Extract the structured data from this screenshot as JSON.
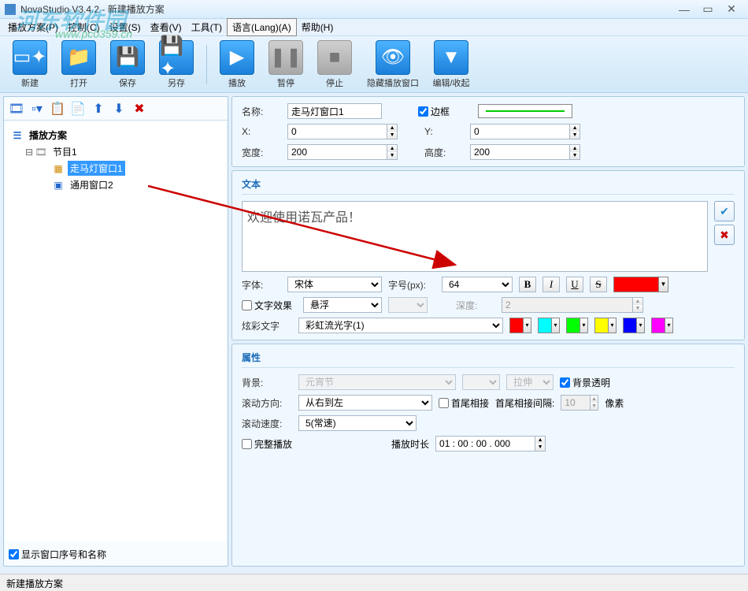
{
  "watermark": {
    "text": "河东软件园",
    "url": "www.pc0359.cn"
  },
  "title": "NovaStudio V3.4.2 - 新建播放方案",
  "menu": [
    "播放方案(P)",
    "控制(C)",
    "设置(S)",
    "查看(V)",
    "工具(T)",
    "语言(Lang)(A)",
    "帮助(H)"
  ],
  "toolbar": [
    {
      "label": "新建",
      "icon": "new"
    },
    {
      "label": "打开",
      "icon": "open"
    },
    {
      "label": "保存",
      "icon": "save"
    },
    {
      "label": "另存",
      "icon": "saveas"
    },
    {
      "label": "播放",
      "icon": "play"
    },
    {
      "label": "暂停",
      "icon": "pause",
      "disabled": true
    },
    {
      "label": "停止",
      "icon": "stop",
      "disabled": true
    },
    {
      "label": "隐藏播放窗口",
      "icon": "hide"
    },
    {
      "label": "编辑/收起",
      "icon": "collapse"
    }
  ],
  "tree": {
    "root": "播放方案",
    "program": "节目1",
    "window1": "走马灯窗口1",
    "window2": "通用窗口2"
  },
  "show_window_label": "显示窗口序号和名称",
  "props": {
    "name_label": "名称:",
    "name_value": "走马灯窗口1",
    "border_label": "边框",
    "x_label": "X:",
    "x_value": "0",
    "y_label": "Y:",
    "y_value": "0",
    "width_label": "宽度:",
    "width_value": "200",
    "height_label": "高度:",
    "height_value": "200"
  },
  "text": {
    "group_label": "文本",
    "content": "欢迎使用诺瓦产品！",
    "font_label": "字体:",
    "font_value": "宋体",
    "size_label": "字号(px):",
    "size_value": "64",
    "bold": "B",
    "italic": "I",
    "underline": "U",
    "strike": "S",
    "color": "#ff0000",
    "effect_label": "文字效果",
    "effect_value": "悬浮",
    "depth_label": "深度:",
    "depth_value": "2",
    "colorful_label": "炫彩文字",
    "colorful_value": "彩虹流光字(1)",
    "swatches": [
      "#ff0000",
      "#00ffff",
      "#00ff00",
      "#ffff00",
      "#0000ff",
      "#ff00ff"
    ]
  },
  "attrs": {
    "group_label": "属性",
    "bg_label": "背景:",
    "bg_value": "元宵节",
    "bg_mode": "拉伸",
    "bg_transparent_label": "背景透明",
    "dir_label": "滚动方向:",
    "dir_value": "从右到左",
    "head_tail_label": "首尾相接",
    "gap_label": "首尾相接间隔:",
    "gap_value": "10",
    "gap_unit": "像素",
    "speed_label": "滚动速度:",
    "speed_value": "5(常速)",
    "full_play_label": "完整播放",
    "duration_label": "播放时长",
    "duration_value": "01 : 00 : 00 . 000"
  },
  "status": "新建播放方案"
}
